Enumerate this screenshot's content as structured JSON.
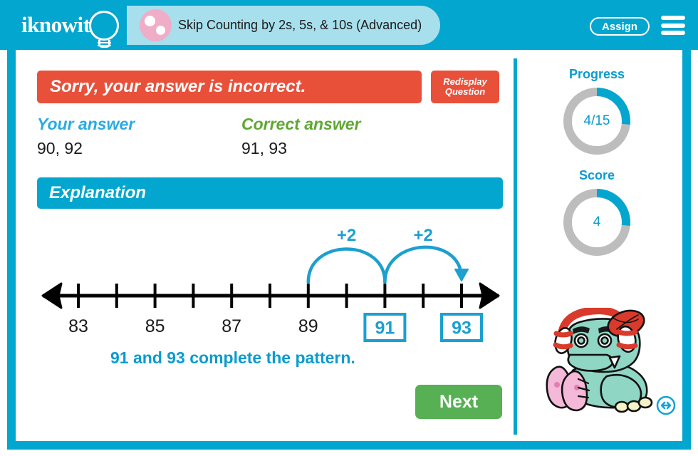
{
  "header": {
    "logo_text": "iknowit",
    "logo_icon": "lightbulb-icon",
    "lesson_title": "Skip Counting by 2s, 5s, & 10s (Advanced)",
    "assign_label": "Assign",
    "menu_icon": "hamburger-menu-icon"
  },
  "result": {
    "banner_message": "Sorry, your answer is incorrect.",
    "redisplay_line1": "Redisplay",
    "redisplay_line2": "Question",
    "your_answer_label": "Your answer",
    "your_answer_value": "90, 92",
    "correct_answer_label": "Correct answer",
    "correct_answer_value": "91, 93",
    "banner_color": "#E8503A",
    "your_answer_color": "#29ABE2",
    "correct_answer_color": "#5EA832"
  },
  "explanation": {
    "heading": "Explanation",
    "summary": "91 and 93 complete the pattern.",
    "accent_color": "#03A6CE",
    "highlight_color": "#0A9BD0"
  },
  "chart_data": {
    "type": "numberline",
    "title": "Explanation",
    "x": [
      83,
      84,
      85,
      86,
      87,
      88,
      89,
      90,
      91,
      92,
      93
    ],
    "tick_labels": [
      "83",
      "",
      "85",
      "",
      "87",
      "",
      "89",
      "",
      "91",
      "",
      "93"
    ],
    "labeled_values": [
      "83",
      "85",
      "87",
      "89",
      "91",
      "93"
    ],
    "boxed_values": [
      "91",
      "93"
    ],
    "jumps": [
      {
        "from": "89",
        "to": "91",
        "label": "+2"
      },
      {
        "from": "91",
        "to": "93",
        "label": "+2"
      }
    ],
    "arrow_both_ends": true,
    "line_color": "#000000",
    "jump_color": "#1BA0D0",
    "box_color": "#1BA0D0"
  },
  "actions": {
    "next_label": "Next"
  },
  "sidebar": {
    "progress_label": "Progress",
    "progress_value": "4/15",
    "progress_fraction": 0.2667,
    "score_label": "Score",
    "score_value": "4",
    "score_fraction": 0.2667,
    "gauge_fill_color": "#03A6CE",
    "gauge_track_color": "#BDBDBD",
    "mascot_icon": "dinosaur-mascot",
    "resize_icon": "resize-handle-icon"
  }
}
